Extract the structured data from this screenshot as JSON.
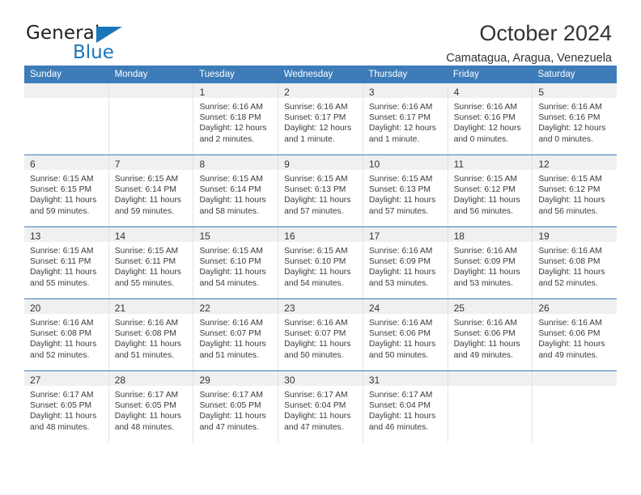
{
  "brand": {
    "name_top": "General",
    "name_bottom": "Blue",
    "accent_color": "#1b75bb"
  },
  "header": {
    "title": "October 2024",
    "subtitle": "Camatagua, Aragua, Venezuela"
  },
  "calendar": {
    "header_bg": "#3d7cb8",
    "daynum_bg": "#f0f0f0",
    "weekdays": [
      "Sunday",
      "Monday",
      "Tuesday",
      "Wednesday",
      "Thursday",
      "Friday",
      "Saturday"
    ],
    "weeks": [
      [
        {
          "day": "",
          "sunrise": "",
          "sunset": "",
          "daylight": ""
        },
        {
          "day": "",
          "sunrise": "",
          "sunset": "",
          "daylight": ""
        },
        {
          "day": "1",
          "sunrise": "Sunrise: 6:16 AM",
          "sunset": "Sunset: 6:18 PM",
          "daylight": "Daylight: 12 hours and 2 minutes."
        },
        {
          "day": "2",
          "sunrise": "Sunrise: 6:16 AM",
          "sunset": "Sunset: 6:17 PM",
          "daylight": "Daylight: 12 hours and 1 minute."
        },
        {
          "day": "3",
          "sunrise": "Sunrise: 6:16 AM",
          "sunset": "Sunset: 6:17 PM",
          "daylight": "Daylight: 12 hours and 1 minute."
        },
        {
          "day": "4",
          "sunrise": "Sunrise: 6:16 AM",
          "sunset": "Sunset: 6:16 PM",
          "daylight": "Daylight: 12 hours and 0 minutes."
        },
        {
          "day": "5",
          "sunrise": "Sunrise: 6:16 AM",
          "sunset": "Sunset: 6:16 PM",
          "daylight": "Daylight: 12 hours and 0 minutes."
        }
      ],
      [
        {
          "day": "6",
          "sunrise": "Sunrise: 6:15 AM",
          "sunset": "Sunset: 6:15 PM",
          "daylight": "Daylight: 11 hours and 59 minutes."
        },
        {
          "day": "7",
          "sunrise": "Sunrise: 6:15 AM",
          "sunset": "Sunset: 6:14 PM",
          "daylight": "Daylight: 11 hours and 59 minutes."
        },
        {
          "day": "8",
          "sunrise": "Sunrise: 6:15 AM",
          "sunset": "Sunset: 6:14 PM",
          "daylight": "Daylight: 11 hours and 58 minutes."
        },
        {
          "day": "9",
          "sunrise": "Sunrise: 6:15 AM",
          "sunset": "Sunset: 6:13 PM",
          "daylight": "Daylight: 11 hours and 57 minutes."
        },
        {
          "day": "10",
          "sunrise": "Sunrise: 6:15 AM",
          "sunset": "Sunset: 6:13 PM",
          "daylight": "Daylight: 11 hours and 57 minutes."
        },
        {
          "day": "11",
          "sunrise": "Sunrise: 6:15 AM",
          "sunset": "Sunset: 6:12 PM",
          "daylight": "Daylight: 11 hours and 56 minutes."
        },
        {
          "day": "12",
          "sunrise": "Sunrise: 6:15 AM",
          "sunset": "Sunset: 6:12 PM",
          "daylight": "Daylight: 11 hours and 56 minutes."
        }
      ],
      [
        {
          "day": "13",
          "sunrise": "Sunrise: 6:15 AM",
          "sunset": "Sunset: 6:11 PM",
          "daylight": "Daylight: 11 hours and 55 minutes."
        },
        {
          "day": "14",
          "sunrise": "Sunrise: 6:15 AM",
          "sunset": "Sunset: 6:11 PM",
          "daylight": "Daylight: 11 hours and 55 minutes."
        },
        {
          "day": "15",
          "sunrise": "Sunrise: 6:15 AM",
          "sunset": "Sunset: 6:10 PM",
          "daylight": "Daylight: 11 hours and 54 minutes."
        },
        {
          "day": "16",
          "sunrise": "Sunrise: 6:15 AM",
          "sunset": "Sunset: 6:10 PM",
          "daylight": "Daylight: 11 hours and 54 minutes."
        },
        {
          "day": "17",
          "sunrise": "Sunrise: 6:16 AM",
          "sunset": "Sunset: 6:09 PM",
          "daylight": "Daylight: 11 hours and 53 minutes."
        },
        {
          "day": "18",
          "sunrise": "Sunrise: 6:16 AM",
          "sunset": "Sunset: 6:09 PM",
          "daylight": "Daylight: 11 hours and 53 minutes."
        },
        {
          "day": "19",
          "sunrise": "Sunrise: 6:16 AM",
          "sunset": "Sunset: 6:08 PM",
          "daylight": "Daylight: 11 hours and 52 minutes."
        }
      ],
      [
        {
          "day": "20",
          "sunrise": "Sunrise: 6:16 AM",
          "sunset": "Sunset: 6:08 PM",
          "daylight": "Daylight: 11 hours and 52 minutes."
        },
        {
          "day": "21",
          "sunrise": "Sunrise: 6:16 AM",
          "sunset": "Sunset: 6:08 PM",
          "daylight": "Daylight: 11 hours and 51 minutes."
        },
        {
          "day": "22",
          "sunrise": "Sunrise: 6:16 AM",
          "sunset": "Sunset: 6:07 PM",
          "daylight": "Daylight: 11 hours and 51 minutes."
        },
        {
          "day": "23",
          "sunrise": "Sunrise: 6:16 AM",
          "sunset": "Sunset: 6:07 PM",
          "daylight": "Daylight: 11 hours and 50 minutes."
        },
        {
          "day": "24",
          "sunrise": "Sunrise: 6:16 AM",
          "sunset": "Sunset: 6:06 PM",
          "daylight": "Daylight: 11 hours and 50 minutes."
        },
        {
          "day": "25",
          "sunrise": "Sunrise: 6:16 AM",
          "sunset": "Sunset: 6:06 PM",
          "daylight": "Daylight: 11 hours and 49 minutes."
        },
        {
          "day": "26",
          "sunrise": "Sunrise: 6:16 AM",
          "sunset": "Sunset: 6:06 PM",
          "daylight": "Daylight: 11 hours and 49 minutes."
        }
      ],
      [
        {
          "day": "27",
          "sunrise": "Sunrise: 6:17 AM",
          "sunset": "Sunset: 6:05 PM",
          "daylight": "Daylight: 11 hours and 48 minutes."
        },
        {
          "day": "28",
          "sunrise": "Sunrise: 6:17 AM",
          "sunset": "Sunset: 6:05 PM",
          "daylight": "Daylight: 11 hours and 48 minutes."
        },
        {
          "day": "29",
          "sunrise": "Sunrise: 6:17 AM",
          "sunset": "Sunset: 6:05 PM",
          "daylight": "Daylight: 11 hours and 47 minutes."
        },
        {
          "day": "30",
          "sunrise": "Sunrise: 6:17 AM",
          "sunset": "Sunset: 6:04 PM",
          "daylight": "Daylight: 11 hours and 47 minutes."
        },
        {
          "day": "31",
          "sunrise": "Sunrise: 6:17 AM",
          "sunset": "Sunset: 6:04 PM",
          "daylight": "Daylight: 11 hours and 46 minutes."
        },
        {
          "day": "",
          "sunrise": "",
          "sunset": "",
          "daylight": ""
        },
        {
          "day": "",
          "sunrise": "",
          "sunset": "",
          "daylight": ""
        }
      ]
    ]
  }
}
